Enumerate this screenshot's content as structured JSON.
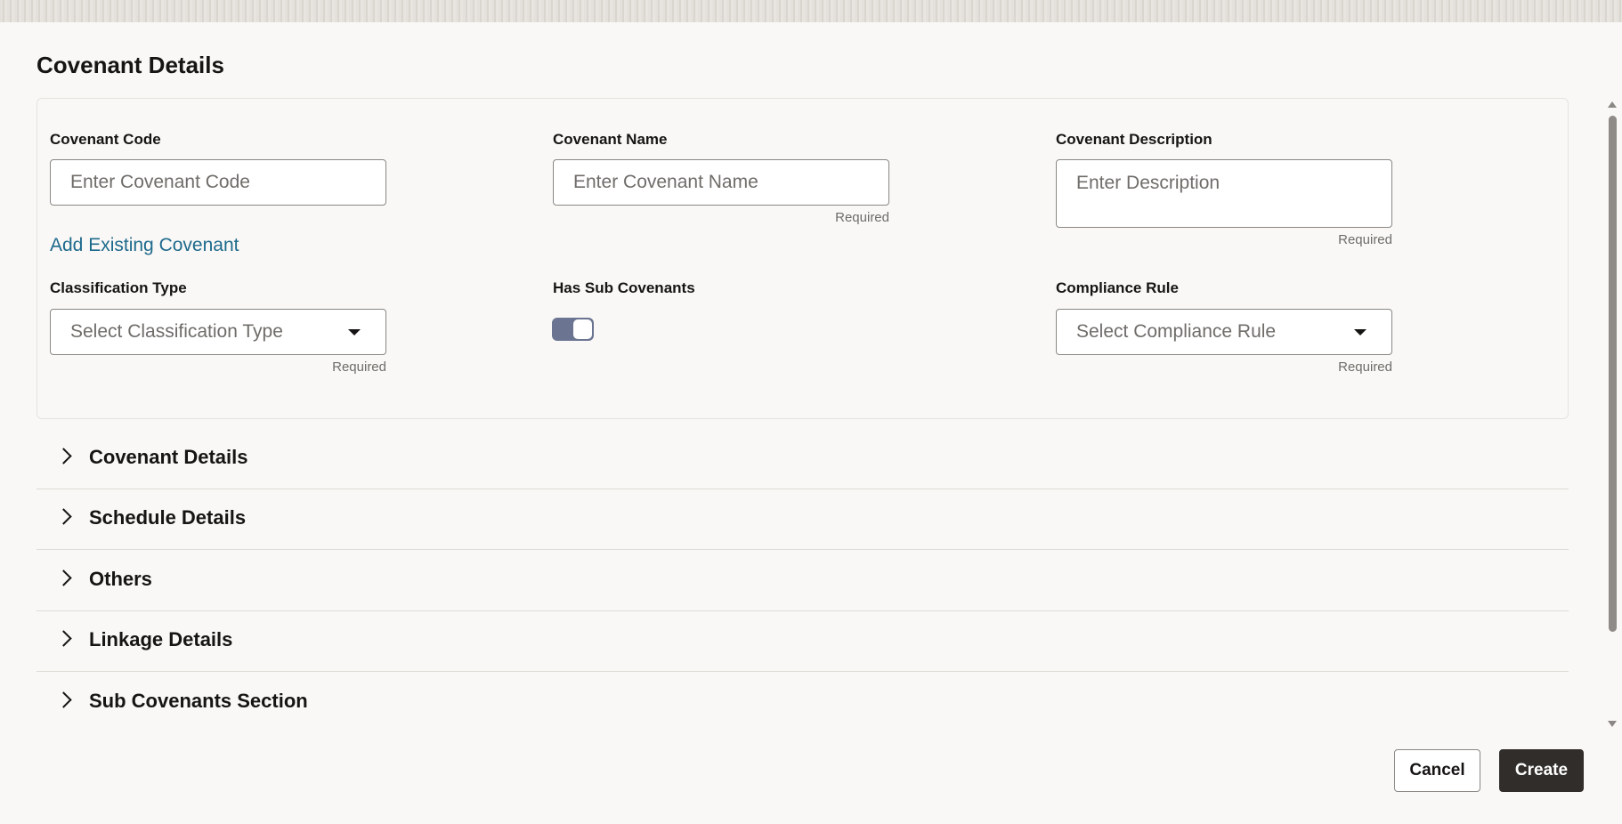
{
  "page": {
    "title": "Covenant Details"
  },
  "form": {
    "covenant_code": {
      "label": "Covenant Code",
      "placeholder": "Enter Covenant Code",
      "value": ""
    },
    "covenant_name": {
      "label": "Covenant Name",
      "placeholder": "Enter Covenant Name",
      "value": "",
      "required": "Required"
    },
    "covenant_description": {
      "label": "Covenant Description",
      "placeholder": "Enter Description",
      "value": "",
      "required": "Required"
    },
    "add_existing_link": "Add Existing Covenant",
    "classification_type": {
      "label": "Classification Type",
      "placeholder": "Select Classification Type",
      "required": "Required"
    },
    "has_sub_covenants": {
      "label": "Has Sub Covenants",
      "on": true
    },
    "compliance_rule": {
      "label": "Compliance Rule",
      "placeholder": "Select Compliance Rule",
      "required": "Required"
    }
  },
  "sections": [
    {
      "label": "Covenant Details",
      "icon": "chevron-right-icon"
    },
    {
      "label": "Schedule Details",
      "icon": "chevron-right-icon"
    },
    {
      "label": "Others",
      "icon": "chevron-right-icon"
    },
    {
      "label": "Linkage Details",
      "icon": "chevron-right-icon"
    },
    {
      "label": "Sub Covenants Section",
      "icon": "chevron-right-icon"
    }
  ],
  "actions": {
    "cancel_label": "Cancel",
    "create_label": "Create"
  },
  "colors": {
    "primary_button": "#312d2a",
    "link": "#1e6a8c",
    "toggle_on": "#6b7491"
  }
}
